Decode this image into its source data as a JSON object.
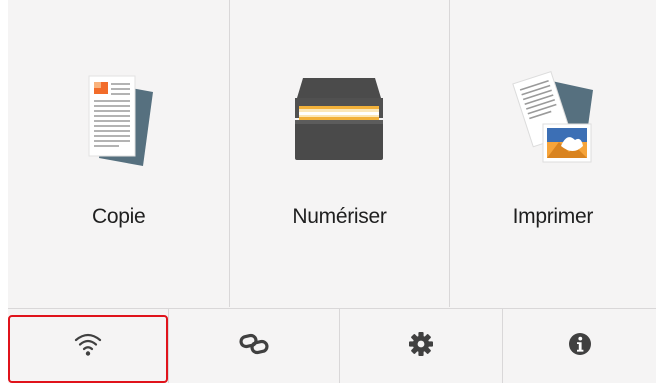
{
  "home": {
    "tiles": [
      {
        "label": "Copie",
        "icon": "copy-document-icon"
      },
      {
        "label": "Numériser",
        "icon": "scanner-icon"
      },
      {
        "label": "Imprimer",
        "icon": "print-photo-icon"
      }
    ],
    "bottom_buttons": [
      {
        "icon": "wifi-icon",
        "selected": true
      },
      {
        "icon": "link-icon",
        "selected": false
      },
      {
        "icon": "gear-icon",
        "selected": false
      },
      {
        "icon": "info-icon",
        "selected": false
      }
    ]
  },
  "colors": {
    "background": "#f5f4f4",
    "divider": "#d9d7d8",
    "selection_outline": "#e0131b",
    "icon_dark": "#404040"
  }
}
